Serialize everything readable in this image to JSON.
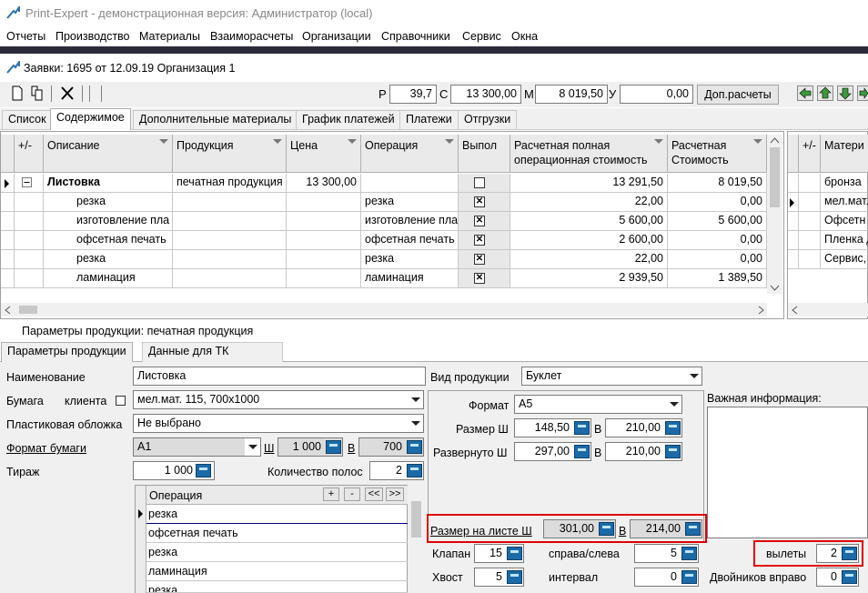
{
  "app": {
    "title": "Print-Expert - демонстрационная версия: Администратор (local)"
  },
  "menu": [
    "Отчеты",
    "Производство",
    "Материалы",
    "Взаиморасчеты",
    "Организации",
    "Справочники",
    "Сервис",
    "Окна"
  ],
  "doc": {
    "title": "Заявки: 1695 от 12.09.19  Организация 1"
  },
  "toolbar": {
    "r_label": "Р",
    "r_value": "39,7",
    "c_label": "С",
    "c_value": "13 300,00",
    "m_label": "М",
    "m_value": "8 019,50",
    "u_label": "У",
    "u_value": "0,00",
    "extra_button": "Доп.расчеты"
  },
  "tabs": [
    "Список",
    "Содержимое",
    "Дополнительные материалы",
    "График платежей",
    "Платежи",
    "Отгрузки"
  ],
  "active_tab": "Содержимое",
  "grid": {
    "headers": [
      "+/-",
      "Описание",
      "Продукция",
      "Цена",
      "Операция",
      "Выпол",
      "Расчетная полная операционная стоимость",
      "Расчетная Стоимость"
    ],
    "rows": [
      {
        "desc": "Листовка",
        "product": "печатная продукция",
        "price": "13 300,00",
        "op": "",
        "done": false,
        "full": "13 291,50",
        "cost": "8 019,50"
      },
      {
        "desc": "резка",
        "product": "",
        "price": "",
        "op": "резка",
        "done": true,
        "full": "22,00",
        "cost": "0,00"
      },
      {
        "desc": "изготовление пла",
        "product": "",
        "price": "",
        "op": "изготовление пла",
        "done": true,
        "full": "5 600,00",
        "cost": "5 600,00"
      },
      {
        "desc": "офсетная печать",
        "product": "",
        "price": "",
        "op": "офсетная печать",
        "done": true,
        "full": "2 600,00",
        "cost": "0,00"
      },
      {
        "desc": "резка",
        "product": "",
        "price": "",
        "op": "резка",
        "done": true,
        "full": "22,00",
        "cost": "0,00"
      },
      {
        "desc": "ламинация",
        "product": "",
        "price": "",
        "op": "ламинация",
        "done": true,
        "full": "2 939,50",
        "cost": "1 389,50"
      }
    ]
  },
  "rgrid": {
    "header": "Матери",
    "rows": [
      "бронза",
      "мел.мат.",
      "Офсетн",
      "Пленка д",
      "Сервис,"
    ]
  },
  "params": {
    "section_title": "Параметры продукции: печатная продукция",
    "tabs": [
      "Параметры продукции",
      "Данные для ТК"
    ],
    "name_label": "Наименование",
    "name_value": "Листовка",
    "paper_label": "Бумага",
    "client_label": "клиента",
    "paper_value": "мел.мат. 115, 700x1000",
    "cover_label": "Пластиковая обложка",
    "cover_value": "Не выбрано",
    "format_label": "Формат бумаги",
    "format_value": "A1",
    "format_w_label": "Ш",
    "format_w": "1 000",
    "format_h_label": "В",
    "format_h": "700",
    "tirazh_label": "Тираж",
    "tirazh_value": "1 000",
    "pages_label": "Количество полос",
    "pages_value": "2",
    "ops_header": "Операция",
    "ops_buttons": [
      "+",
      "-",
      "<<",
      ">>"
    ],
    "ops": [
      "резка",
      "офсетная печать",
      "резка",
      "ламинация",
      "резка"
    ],
    "kind_label": "Вид продукции",
    "kind_value": "Буклет",
    "fmt_label": "Формат",
    "fmt_value": "A5",
    "size_label": "Размер Ш",
    "size_w": "148,50",
    "size_h_label": "В",
    "size_h": "210,00",
    "unfold_label": "Развернуто Ш",
    "unfold_w": "297,00",
    "unfold_h_label": "В",
    "unfold_h": "210,00",
    "important_label": "Важная информация:",
    "sheet_label": "Размер на листе Ш",
    "sheet_w": "301,00",
    "sheet_h_label": "В",
    "sheet_h": "214,00",
    "klapan_label": "Клапан",
    "klapan_value": "15",
    "side_label": "справа/слева",
    "side_value": "5",
    "vylety_label": "вылеты",
    "vylety_value": "2",
    "tail_label": "Хвост",
    "tail_value": "5",
    "interval_label": "интервал",
    "interval_value": "0",
    "twins_label": "Двойников вправо",
    "twins_value": "0"
  }
}
